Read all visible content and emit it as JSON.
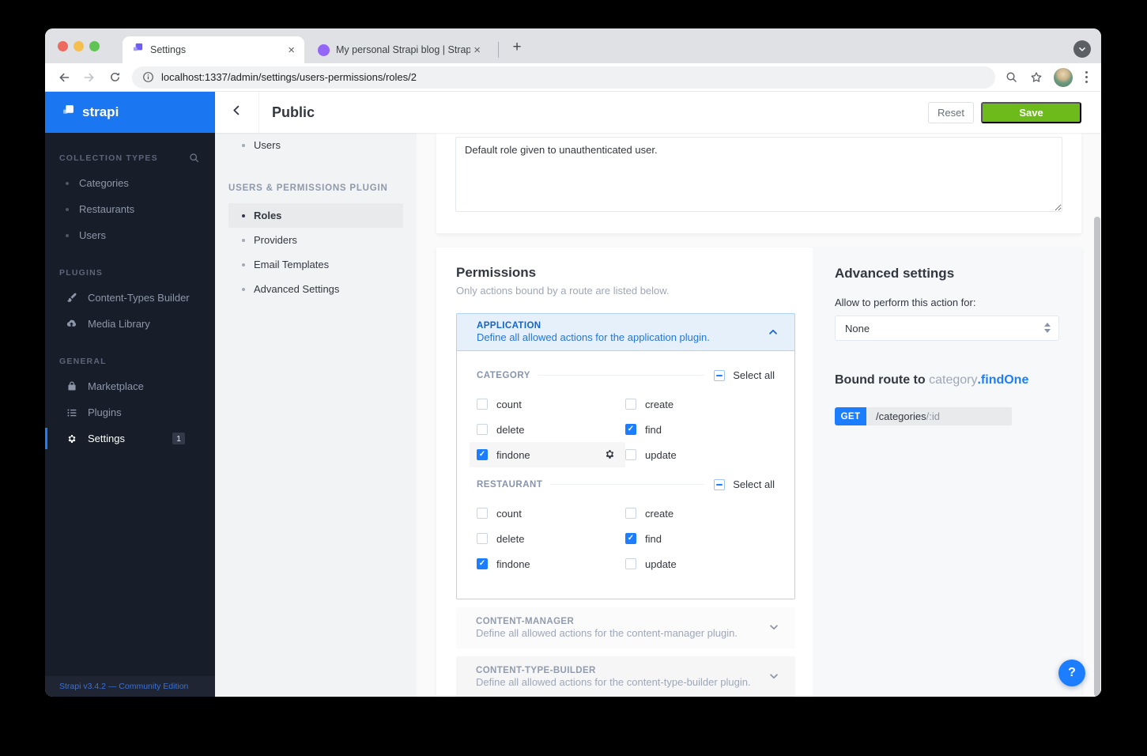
{
  "browser": {
    "tab1": {
      "title": "Settings"
    },
    "tab2": {
      "title": "My personal Strapi blog | Strap"
    },
    "url": "localhost:1337/admin/settings/users-permissions/roles/2",
    "glyphs": {
      "close": "×",
      "new_tab": "+"
    }
  },
  "sidebar": {
    "logo_text": "strapi",
    "sections": [
      {
        "title": "COLLECTION TYPES",
        "items": [
          {
            "label": "Categories"
          },
          {
            "label": "Restaurants"
          },
          {
            "label": "Users"
          }
        ]
      },
      {
        "title": "PLUGINS",
        "items": [
          {
            "label": "Content-Types Builder",
            "icon": "brush-icon"
          },
          {
            "label": "Media Library",
            "icon": "cloud-upload-icon"
          }
        ]
      },
      {
        "title": "GENERAL",
        "items": [
          {
            "label": "Marketplace",
            "icon": "bag-icon"
          },
          {
            "label": "Plugins",
            "icon": "list-icon"
          },
          {
            "label": "Settings",
            "icon": "gear-icon",
            "badge": "1",
            "active": true
          }
        ]
      }
    ],
    "footer": "Strapi v3.4.2 — Community Edition"
  },
  "header": {
    "title": "Public",
    "reset_label": "Reset",
    "save_label": "Save"
  },
  "subnav": {
    "top_item": "Users",
    "section_title": "USERS & PERMISSIONS PLUGIN",
    "items": [
      {
        "label": "Roles",
        "active": true
      },
      {
        "label": "Providers"
      },
      {
        "label": "Email Templates"
      },
      {
        "label": "Advanced Settings"
      }
    ]
  },
  "role_form": {
    "description_value": "Default role given to unauthenticated user."
  },
  "permissions": {
    "title": "Permissions",
    "subtitle": "Only actions bound by a route are listed below.",
    "application": {
      "name": "APPLICATION",
      "description": "Define all allowed actions for the application plugin."
    },
    "groups": [
      {
        "name": "CATEGORY",
        "select_all_label": "Select all",
        "left_actions": [
          {
            "label": "count",
            "checked": false
          },
          {
            "label": "delete",
            "checked": false
          },
          {
            "label": "findone",
            "checked": true,
            "highlighted": true
          }
        ],
        "right_actions": [
          {
            "label": "create",
            "checked": false
          },
          {
            "label": "find",
            "checked": true
          },
          {
            "label": "update",
            "checked": false
          }
        ]
      },
      {
        "name": "RESTAURANT",
        "select_all_label": "Select all",
        "left_actions": [
          {
            "label": "count",
            "checked": false
          },
          {
            "label": "delete",
            "checked": false
          },
          {
            "label": "findone",
            "checked": true
          }
        ],
        "right_actions": [
          {
            "label": "create",
            "checked": false
          },
          {
            "label": "find",
            "checked": true
          },
          {
            "label": "update",
            "checked": false
          }
        ]
      }
    ],
    "collapsed": [
      {
        "name": "CONTENT-MANAGER",
        "description": "Define all allowed actions for the content-manager plugin."
      },
      {
        "name": "CONTENT-TYPE-BUILDER",
        "description": "Define all allowed actions for the content-type-builder plugin."
      }
    ]
  },
  "advanced": {
    "title": "Advanced settings",
    "allow_label": "Allow to perform this action for:",
    "select_value": "None",
    "bound_route_prefix": "Bound route to ",
    "bound_route_controller": "category",
    "bound_route_action": ".findOne",
    "method": "GET",
    "route_path": "/categories",
    "route_param": "/:id"
  },
  "help_label": "?",
  "colors": {
    "primary_blue": "#1c7eff",
    "save_green": "#6dbb1a",
    "logo_blue": "#1b76f2",
    "tab_purple": "#9466f8"
  }
}
